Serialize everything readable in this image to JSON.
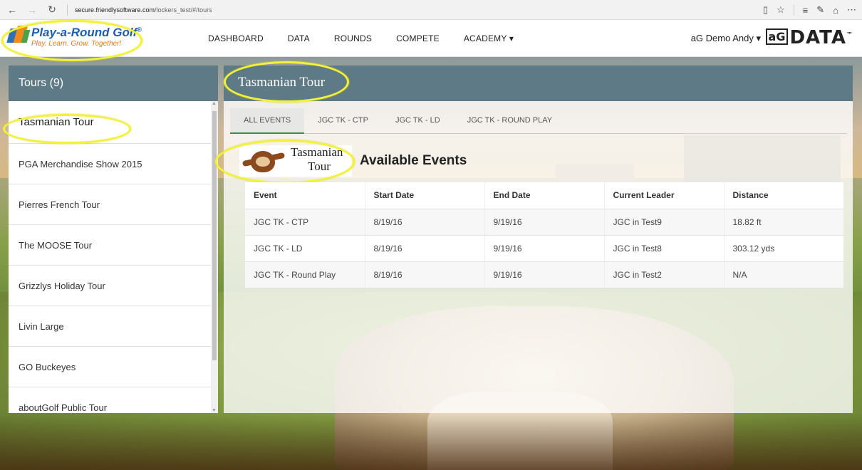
{
  "browser": {
    "url_host": "secure.friendlysoftware.com",
    "url_path": "/lockers_test/#/tours"
  },
  "brand": {
    "name": "Play-a-Round Golf",
    "registered": "®",
    "tagline": "Play. Learn. Grow. Together!"
  },
  "nav": {
    "items": [
      "DASHBOARD",
      "DATA",
      "ROUNDS",
      "COMPETE"
    ],
    "academy": "ACADEMY ▾",
    "user": "aG Demo Andy ▾",
    "product_box": "aG",
    "product": "DATA",
    "product_tm": "™"
  },
  "tours": {
    "header": "Tours (9)",
    "items": [
      "Tasmanian Tour",
      "PGA Merchandise Show 2015",
      "Pierres French Tour",
      "The MOOSE Tour",
      "Grizzlys Holiday Tour",
      "Livin Large",
      "GO Buckeyes",
      "aboutGolf Public Tour"
    ]
  },
  "main": {
    "title": "Tasmanian Tour",
    "tabs": [
      "ALL EVENTS",
      "JGC TK - CTP",
      "JGC TK - LD",
      "JGC TK - ROUND PLAY"
    ],
    "logo_line1": "Tasmanian",
    "logo_line2": "Tour",
    "section_title": "Available Events",
    "table": {
      "headers": [
        "Event",
        "Start Date",
        "End Date",
        "Current Leader",
        "Distance"
      ],
      "rows": [
        [
          "JGC TK - CTP",
          "8/19/16",
          "9/19/16",
          "JGC in Test9",
          "18.82 ft"
        ],
        [
          "JGC TK - LD",
          "8/19/16",
          "9/19/16",
          "JGC in Test8",
          "303.12 yds"
        ],
        [
          "JGC TK - Round Play",
          "8/19/16",
          "9/19/16",
          "JGC in Test2",
          "N/A"
        ]
      ]
    }
  },
  "colors": {
    "panel_header": "#5e7a86",
    "highlight": "#f2f23a",
    "active_tab_underline": "#3e8a3e"
  }
}
